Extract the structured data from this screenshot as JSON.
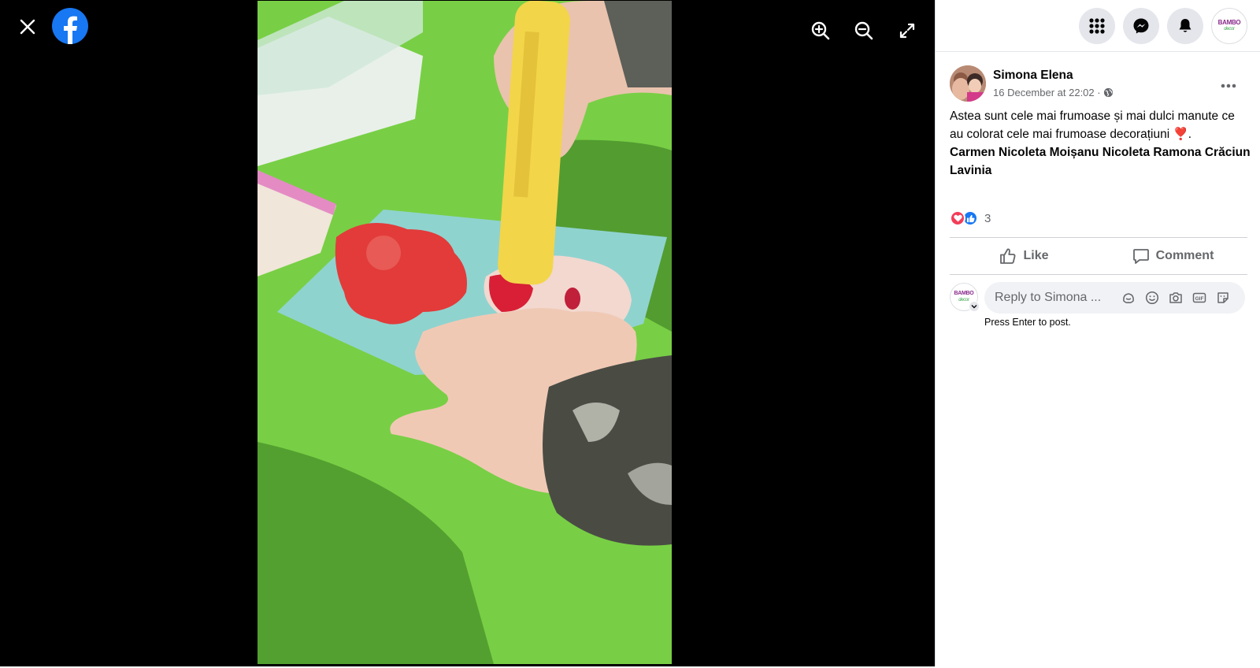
{
  "viewer": {
    "icons": {
      "close": "close-icon",
      "logo": "facebook-logo",
      "zoom_in": "zoom-in-icon",
      "zoom_out": "zoom-out-icon",
      "fullscreen": "fullscreen-icon"
    }
  },
  "topbar": {
    "icons": [
      "menu-grid-icon",
      "messenger-icon",
      "bell-icon",
      "account-avatar"
    ],
    "account_logo": {
      "brand": "BAMBO",
      "sub": "decor"
    }
  },
  "post": {
    "author": "Simona Elena",
    "timestamp": "16 December at 22:02 ·",
    "audience_icon": "globe-icon",
    "text": "Astea sunt cele mai frumoase și mai dulci manute ce au colorat cele mai frumoase decorațiuni ❣️.",
    "tags": "Carmen Nicoleta Moișanu Nicoleta Ramona Crăciun Lavinia",
    "reaction_count": "3",
    "reactions": [
      "love",
      "like"
    ]
  },
  "actions": {
    "like_label": "Like",
    "comment_label": "Comment"
  },
  "comment": {
    "placeholder": "Reply to Simona ...",
    "hint": "Press Enter to post.",
    "icons": [
      "avatar-sticker-icon",
      "emoji-icon",
      "camera-icon",
      "gif-icon",
      "sticker-icon"
    ]
  },
  "colors": {
    "accent": "#1877f2",
    "love": "#f33e58",
    "viewer_bg": "#000000",
    "muted": "#65676b"
  }
}
